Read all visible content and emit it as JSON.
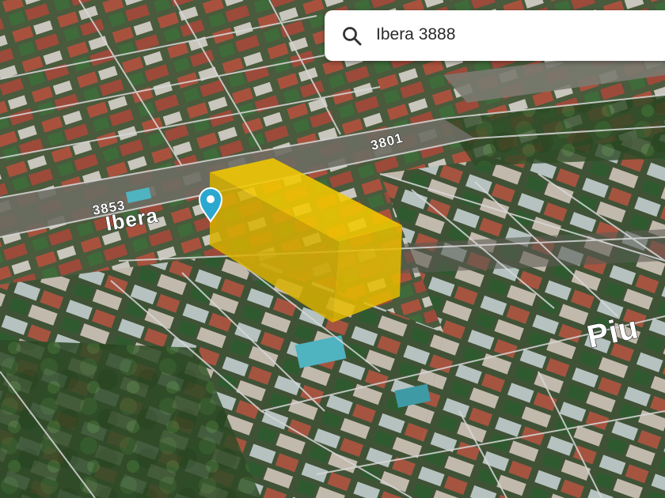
{
  "search": {
    "query": "Ibera 3888",
    "icon": "search-icon"
  },
  "map": {
    "marker_icon": "map-pin-icon",
    "marker_color": "#2aa8d0",
    "highlight_color": "#f0c400",
    "street_labels": [
      {
        "name": "house-number-3853",
        "text": "3853"
      },
      {
        "name": "street-name-ibera",
        "text": "Ibera"
      },
      {
        "name": "house-number-3801",
        "text": "3801"
      },
      {
        "name": "street-name-piu",
        "text": "Piu"
      }
    ]
  }
}
